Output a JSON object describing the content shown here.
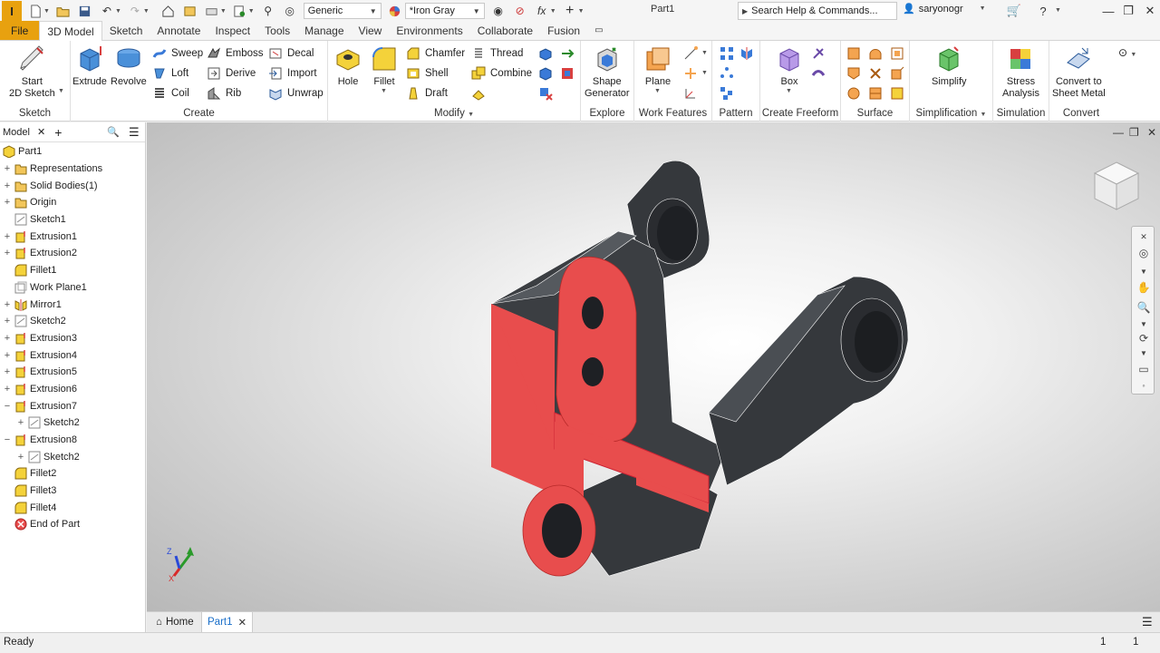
{
  "app": {
    "logo": "I",
    "title": "Part1"
  },
  "quick_access": {
    "appearance_value": "Generic",
    "material_value": "*Iron Gray"
  },
  "help": {
    "search_placeholder": "Search Help & Commands..."
  },
  "user": {
    "name": "saryonogr"
  },
  "ribbon_tabs": [
    "File",
    "3D Model",
    "Sketch",
    "Annotate",
    "Inspect",
    "Tools",
    "Manage",
    "View",
    "Environments",
    "Collaborate",
    "Fusion"
  ],
  "ribbon": {
    "sketch": {
      "label": "Sketch",
      "start_line1": "Start",
      "start_line2": "2D Sketch"
    },
    "create": {
      "label": "Create",
      "extrude": "Extrude",
      "revolve": "Revolve",
      "sweep": "Sweep",
      "loft": "Loft",
      "coil": "Coil",
      "emboss": "Emboss",
      "derive": "Derive",
      "rib": "Rib",
      "decal": "Decal",
      "import": "Import",
      "unwrap": "Unwrap"
    },
    "modify": {
      "label": "Modify",
      "hole": "Hole",
      "fillet": "Fillet",
      "chamfer": "Chamfer",
      "shell": "Shell",
      "draft": "Draft",
      "thread": "Thread",
      "combine": "Combine"
    },
    "explore": {
      "label": "Explore",
      "shape_line1": "Shape",
      "shape_line2": "Generator"
    },
    "work_features": {
      "label": "Work Features",
      "plane": "Plane"
    },
    "pattern": {
      "label": "Pattern"
    },
    "freeform": {
      "label": "Create Freeform",
      "box": "Box"
    },
    "surface": {
      "label": "Surface"
    },
    "simplification": {
      "label": "Simplification",
      "simplify": "Simplify"
    },
    "simulation": {
      "label": "Simulation",
      "stress_line1": "Stress",
      "stress_line2": "Analysis"
    },
    "convert": {
      "label": "Convert",
      "sheet_line1": "Convert to",
      "sheet_line2": "Sheet Metal"
    }
  },
  "browser": {
    "tab_label": "Model",
    "nodes": [
      {
        "label": "Part1",
        "exp": "",
        "indent": 0,
        "icon": "part"
      },
      {
        "label": "Representations",
        "exp": "+",
        "indent": 0,
        "icon": "folder"
      },
      {
        "label": "Solid Bodies(1)",
        "exp": "+",
        "indent": 0,
        "icon": "folder"
      },
      {
        "label": "Origin",
        "exp": "+",
        "indent": 0,
        "icon": "folder"
      },
      {
        "label": "Sketch1",
        "exp": "",
        "indent": 0,
        "icon": "sketch"
      },
      {
        "label": "Extrusion1",
        "exp": "+",
        "indent": 0,
        "icon": "extrude"
      },
      {
        "label": "Extrusion2",
        "exp": "+",
        "indent": 0,
        "icon": "extrude"
      },
      {
        "label": "Fillet1",
        "exp": "",
        "indent": 0,
        "icon": "fillet"
      },
      {
        "label": "Work Plane1",
        "exp": "",
        "indent": 0,
        "icon": "plane"
      },
      {
        "label": "Mirror1",
        "exp": "+",
        "indent": 0,
        "icon": "mirror"
      },
      {
        "label": "Sketch2",
        "exp": "+",
        "indent": 0,
        "icon": "sketch"
      },
      {
        "label": "Extrusion3",
        "exp": "+",
        "indent": 0,
        "icon": "extrude"
      },
      {
        "label": "Extrusion4",
        "exp": "+",
        "indent": 0,
        "icon": "extrude"
      },
      {
        "label": "Extrusion5",
        "exp": "+",
        "indent": 0,
        "icon": "extrude"
      },
      {
        "label": "Extrusion6",
        "exp": "+",
        "indent": 0,
        "icon": "extrude"
      },
      {
        "label": "Extrusion7",
        "exp": "−",
        "indent": 0,
        "icon": "extrude"
      },
      {
        "label": "Sketch2",
        "exp": "+",
        "indent": 1,
        "icon": "sketch"
      },
      {
        "label": "Extrusion8",
        "exp": "−",
        "indent": 0,
        "icon": "extrude"
      },
      {
        "label": "Sketch2",
        "exp": "+",
        "indent": 1,
        "icon": "sketch"
      },
      {
        "label": "Fillet2",
        "exp": "",
        "indent": 0,
        "icon": "fillet"
      },
      {
        "label": "Fillet3",
        "exp": "",
        "indent": 0,
        "icon": "fillet"
      },
      {
        "label": "Fillet4",
        "exp": "",
        "indent": 0,
        "icon": "fillet"
      },
      {
        "label": "End of Part",
        "exp": "",
        "indent": 0,
        "icon": "end"
      }
    ]
  },
  "axes": {
    "z": "Z",
    "y": "Y",
    "x": "X"
  },
  "doc_tabs": {
    "home": "Home",
    "part": "Part1"
  },
  "status": {
    "left": "Ready",
    "num1": "1",
    "num2": "1"
  },
  "colors": {
    "accent_orange": "#e8a10f",
    "section_red": "#e84d4d",
    "body_dark": "#3b3e42",
    "tab_blue": "#1a6fc9"
  }
}
